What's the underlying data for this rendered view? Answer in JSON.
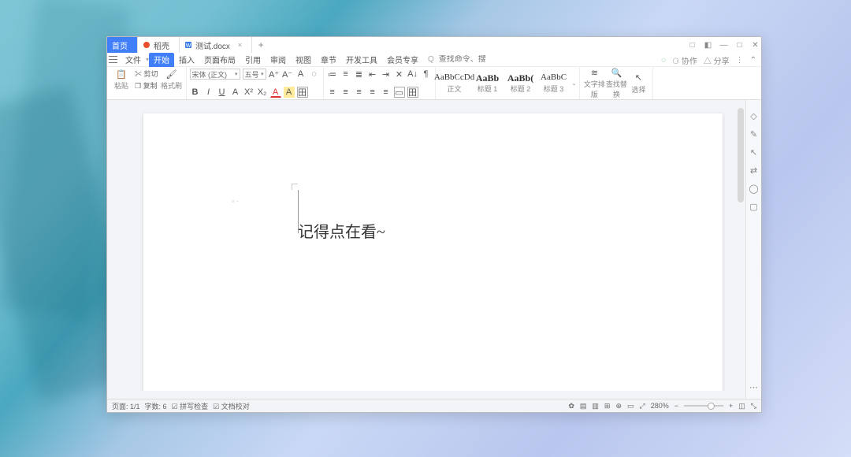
{
  "titlebar": {
    "tab_home": "首页",
    "tab_app": "稻壳",
    "tab_doc": "测试.docx",
    "tab_close": "×",
    "new_tab": "+"
  },
  "winbuttons": {
    "a": "□",
    "b": "◧",
    "min": "—",
    "max": "□",
    "close": "✕"
  },
  "menus": {
    "file": "文件",
    "start": "开始",
    "insert": "插入",
    "layout": "页面布局",
    "ref": "引用",
    "review": "审阅",
    "view": "视图",
    "section": "章节",
    "devtools": "开发工具",
    "member": "会员专享",
    "search_icon": "Q",
    "search_placeholder": "查找命令、搜索模板"
  },
  "menuright": {
    "cloud": "◌",
    "coop": "⚆ 协作",
    "share": "△ 分享",
    "more": "⋮",
    "collapse": "⌃"
  },
  "ribbon": {
    "paste": "粘贴",
    "copy": "复制",
    "cut": "剪切",
    "brush": "格式刷",
    "font_name": "宋体 (正文)",
    "font_size": "五号",
    "bold": "B",
    "italic": "I",
    "under": "U",
    "strike": "A",
    "sup": "X²",
    "sub": "X₂",
    "caseA": "A",
    "clear": "◌",
    "color": "A",
    "hilite": "A",
    "border": "田",
    "incA": "A⁺",
    "decA": "A⁻",
    "bul": "≔",
    "num": "≡",
    "multi": "≣",
    "indentL": "⇤",
    "indentR": "⇥",
    "tabstops": "✕",
    "sortA": "A↓",
    "pilcrow": "¶",
    "alignL": "≡",
    "alignC": "≡",
    "alignR": "≡",
    "alignJ": "≡",
    "lineH": "≡",
    "fill": "▭",
    "borders": "田",
    "style_prev_normal": "AaBbCcDd",
    "style_normal": "正文",
    "style_prev_h1": "AaBb",
    "style_h1": "标题 1",
    "style_prev_h2": "AaBb(",
    "style_h2": "标题 2",
    "style_prev_h3": "AaBbC",
    "style_h3": "标题 3",
    "text_tools": "文字排版",
    "find_replace": "查找替换",
    "select": "选择"
  },
  "document": {
    "page_marker": "▫ ·",
    "body": "记得点在看~"
  },
  "sidebar": {
    "i1": "◇",
    "i2": "✎",
    "i3": "↖",
    "i4": "⇄",
    "i5": "◯",
    "i6": "▢",
    "i7": "⋯"
  },
  "status": {
    "page": "页面: 1/1",
    "words": "字数: 6",
    "spell": "拼写检查",
    "doccheck": "文档校对",
    "zoom": "280%",
    "zoom_out": "−",
    "zoom_in": "+",
    "v1": "✿",
    "v2": "▤",
    "v3": "▥",
    "v4": "⊞",
    "v5": "⊕",
    "v6": "▭",
    "v7": "⤢",
    "v8": "◫",
    "v9": "⤡"
  }
}
